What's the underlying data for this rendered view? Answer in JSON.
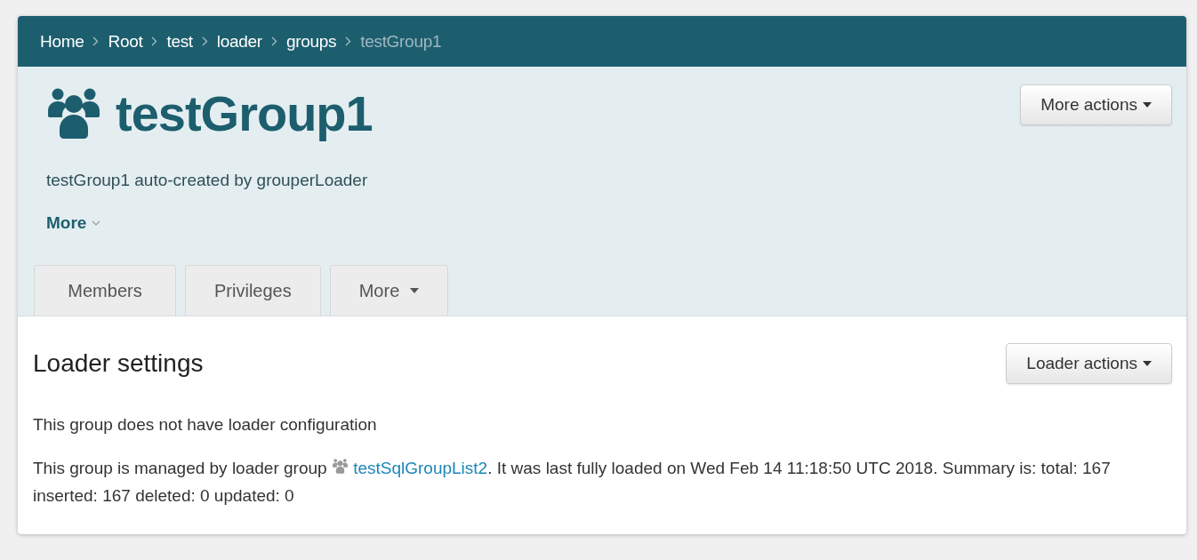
{
  "breadcrumb": [
    {
      "label": "Home",
      "current": false
    },
    {
      "label": "Root",
      "current": false
    },
    {
      "label": "test",
      "current": false
    },
    {
      "label": "loader",
      "current": false
    },
    {
      "label": "groups",
      "current": false
    },
    {
      "label": "testGroup1",
      "current": true
    }
  ],
  "header": {
    "title": "testGroup1",
    "description": "testGroup1 auto-created by grouperLoader",
    "more_link": "More",
    "actions_button": "More actions"
  },
  "tabs": [
    {
      "label": "Members",
      "selected": false,
      "dropdown": false
    },
    {
      "label": "Privileges",
      "selected": false,
      "dropdown": false
    },
    {
      "label": "More",
      "selected": false,
      "dropdown": true
    }
  ],
  "section": {
    "title": "Loader settings",
    "actions_button": "Loader actions",
    "note": "This group does not have loader configuration",
    "managed_before": "This group is managed by loader group",
    "managed_link": "testSqlGroupList2",
    "managed_after": ". It was last fully loaded on Wed Feb 14 11:18:50 UTC 2018. Summary is: total: 167 inserted: 167 deleted: 0 updated: 0"
  }
}
